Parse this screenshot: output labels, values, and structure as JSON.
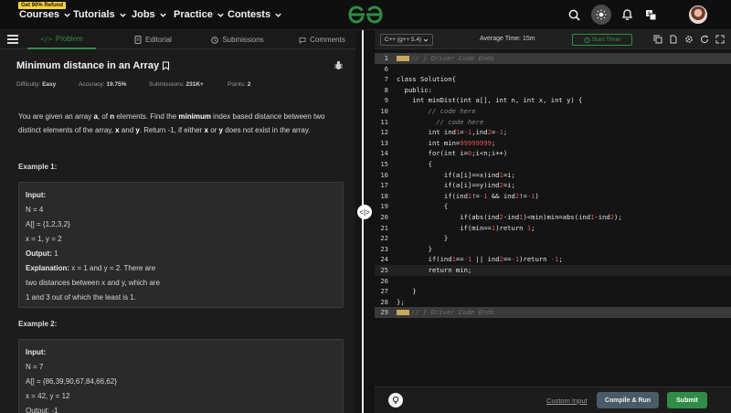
{
  "topnav": {
    "promo_badge": "Get 90% Refund",
    "items": [
      "Courses",
      "Tutorials",
      "Jobs",
      "Practice",
      "Contests"
    ],
    "logo_color": "#2f8d46"
  },
  "tabs": {
    "problem": "Problem",
    "editorial": "Editorial",
    "submissions": "Submissions",
    "comments": "Comments"
  },
  "problem": {
    "title": "Minimum distance in an Array",
    "difficulty_label": "Difficulty:",
    "difficulty_value": "Easy",
    "accuracy_label": "Accuracy:",
    "accuracy_value": "19.75%",
    "submissions_label": "Submissions:",
    "submissions_value": "231K+",
    "points_label": "Points:",
    "points_value": "2",
    "desc_parts": {
      "p1": "You are given an array ",
      "a": "a",
      "p2": ", of ",
      "n": "n",
      "p3": " elements. Find the ",
      "minimum": "minimum",
      "p4": " index based distance between two distinct elements of the array, ",
      "x": "x",
      "p5": " and ",
      "y": "y",
      "p6": ". Return -1, if either ",
      "x2": "x",
      "p7": " or ",
      "y2": "y",
      "p8": " does not exist in the array."
    },
    "example1": {
      "title": "Example 1:",
      "input_label": "Input:",
      "n_line": "N = 4",
      "a_line": "A[] = {1,2,3,2}",
      "xy_line": "x = 1, y = 2",
      "output_label": "Output:",
      "output_value": "1",
      "explanation_label": "Explanation:",
      "explanation_1": " x = 1 and y = 2. There are",
      "explanation_2": "two distances between x and y, which are",
      "explanation_3": "1 and 3 out of which the least is 1."
    },
    "example2": {
      "title": "Example 2:",
      "input_label": "Input:",
      "n_line": "N = 7",
      "a_line": "A[] = {86,39,90,67,84,66,62}",
      "xy_line": "x = 42, y = 12",
      "output_partial": "Output: -1"
    }
  },
  "editor": {
    "language": "C++ (g++ 5.4)",
    "avg_time": "Average Time: 15m",
    "start_timer": "Start Timer",
    "custom_input": "Custom Input",
    "compile_run": "Compile & Run",
    "submit": "Submit",
    "lines": [
      {
        "n": "1",
        "fold": true,
        "text": "// } Driver Code Ends"
      },
      {
        "n": "6",
        "fold": false,
        "text": ""
      },
      {
        "n": "7",
        "fold": false,
        "text": "class Solution{"
      },
      {
        "n": "8",
        "fold": false,
        "text": "  public:"
      },
      {
        "n": "9",
        "fold": false,
        "text": "    int minDist(int a[], int n, int x, int y) {"
      },
      {
        "n": "10",
        "fold": false,
        "text": "        // code here",
        "comment": true
      },
      {
        "n": "11",
        "fold": false,
        "text": "          // code here",
        "comment": true
      },
      {
        "n": "12",
        "fold": false,
        "text": "        int ind1=-1,ind2=-1;"
      },
      {
        "n": "13",
        "fold": false,
        "text": "        int min=99999999;"
      },
      {
        "n": "14",
        "fold": false,
        "text": "        for(int i=0;i<n;i++)"
      },
      {
        "n": "15",
        "fold": false,
        "text": "        {"
      },
      {
        "n": "16",
        "fold": false,
        "text": "            if(a[i]==x)ind1=i;"
      },
      {
        "n": "17",
        "fold": false,
        "text": "            if(a[i]==y)ind2=i;"
      },
      {
        "n": "18",
        "fold": false,
        "text": "            if(ind1!=-1 && ind2!=-1)"
      },
      {
        "n": "19",
        "fold": false,
        "text": "            {"
      },
      {
        "n": "20",
        "fold": false,
        "text": "                if(abs(ind2-ind1)<min)min=abs(ind1-ind2);"
      },
      {
        "n": "21",
        "fold": false,
        "text": "                if(min==1)return 1;"
      },
      {
        "n": "22",
        "fold": false,
        "text": "            }"
      },
      {
        "n": "23",
        "fold": false,
        "text": "        }"
      },
      {
        "n": "24",
        "fold": false,
        "text": "        if(ind1==-1 || ind2==-1)return -1;"
      },
      {
        "n": "25",
        "fold": false,
        "text": "        return min;"
      },
      {
        "n": "26",
        "fold": false,
        "text": ""
      },
      {
        "n": "27",
        "fold": false,
        "text": "    }"
      },
      {
        "n": "28",
        "fold": false,
        "text": "};"
      },
      {
        "n": "29",
        "fold": true,
        "text": "// } Driver Code Ends"
      }
    ]
  },
  "colors": {
    "accent_green": "#2f8d46",
    "number_red": "#e0554f",
    "compile_bg": "#4a5b68"
  }
}
